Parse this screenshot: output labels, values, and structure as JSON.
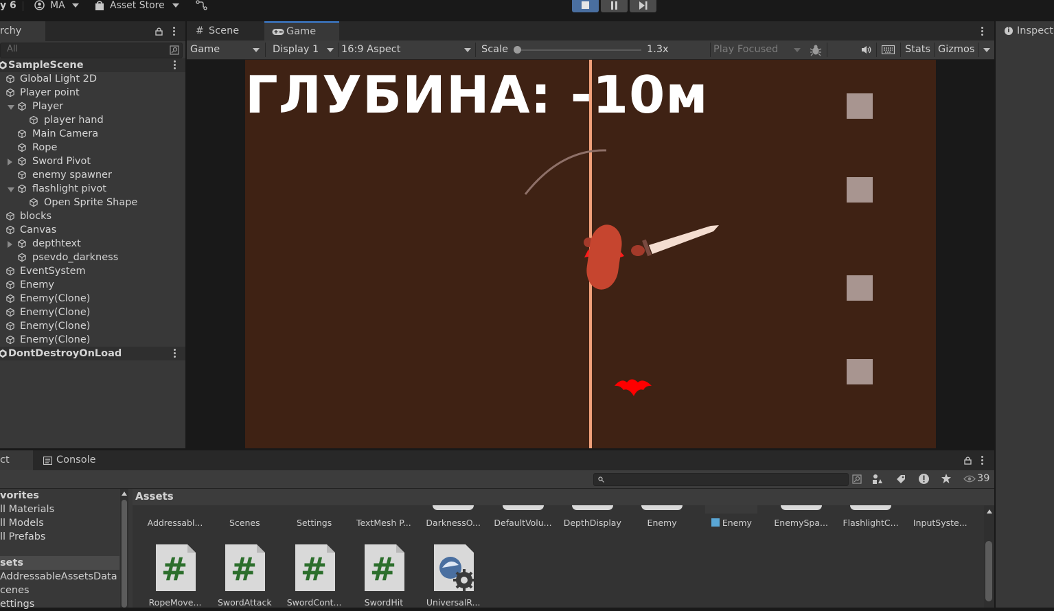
{
  "toolbar": {
    "app_fragment": "y 6",
    "account": "MA",
    "asset_store": "Asset Store"
  },
  "hierarchy": {
    "tab_label": "rchy",
    "search_placeholder": "All",
    "rows": [
      {
        "label": "SampleScene",
        "depth": 0,
        "arrow": "",
        "type": "scene"
      },
      {
        "label": "Global Light 2D",
        "depth": 1,
        "arrow": "",
        "type": "object"
      },
      {
        "label": "Player point",
        "depth": 1,
        "arrow": "",
        "type": "object"
      },
      {
        "label": "Player",
        "depth": 2,
        "arrow": "down",
        "type": "object"
      },
      {
        "label": "player hand",
        "depth": 3,
        "arrow": "",
        "type": "object"
      },
      {
        "label": "Main Camera",
        "depth": 2,
        "arrow": "",
        "type": "object"
      },
      {
        "label": "Rope",
        "depth": 2,
        "arrow": "",
        "type": "object"
      },
      {
        "label": "Sword Pivot",
        "depth": 2,
        "arrow": "right",
        "type": "object"
      },
      {
        "label": "enemy spawner",
        "depth": 2,
        "arrow": "",
        "type": "object"
      },
      {
        "label": "flashlight pivot",
        "depth": 2,
        "arrow": "down",
        "type": "object"
      },
      {
        "label": "Open Sprite Shape",
        "depth": 3,
        "arrow": "",
        "type": "object"
      },
      {
        "label": "blocks",
        "depth": 1,
        "arrow": "",
        "type": "object"
      },
      {
        "label": "Canvas",
        "depth": 1,
        "arrow": "",
        "type": "object"
      },
      {
        "label": "depthtext",
        "depth": 2,
        "arrow": "right",
        "type": "object"
      },
      {
        "label": "psevdo_darkness",
        "depth": 2,
        "arrow": "",
        "type": "object"
      },
      {
        "label": "EventSystem",
        "depth": 1,
        "arrow": "",
        "type": "object"
      },
      {
        "label": "Enemy",
        "depth": 1,
        "arrow": "",
        "type": "object"
      },
      {
        "label": "Enemy(Clone)",
        "depth": 1,
        "arrow": "",
        "type": "object"
      },
      {
        "label": "Enemy(Clone)",
        "depth": 1,
        "arrow": "",
        "type": "object"
      },
      {
        "label": "Enemy(Clone)",
        "depth": 1,
        "arrow": "",
        "type": "object"
      },
      {
        "label": "Enemy(Clone)",
        "depth": 1,
        "arrow": "",
        "type": "object"
      },
      {
        "label": "DontDestroyOnLoad",
        "depth": 0,
        "arrow": "",
        "type": "scene"
      }
    ]
  },
  "game_view": {
    "tabs": {
      "scene": "Scene",
      "game": "Game"
    },
    "controls": {
      "mode": "Game",
      "display": "Display 1",
      "aspect": "16:9 Aspect",
      "scale_label": "Scale",
      "scale_value": "1.3x",
      "play_focused": "Play Focused",
      "stats": "Stats",
      "gizmos": "Gizmos"
    },
    "depth_text": "ГЛУБИНА: -10м"
  },
  "inspector": {
    "tab_label": "Inspect"
  },
  "bottom": {
    "project_tab": "ct",
    "console_tab": "Console",
    "hidden_count": "39",
    "favorites": [
      "vorites",
      "ll Materials",
      "ll Models",
      "ll Prefabs"
    ],
    "assets_tree": [
      "sets",
      "AddressableAssetsData",
      "cenes",
      "ettings"
    ],
    "assets_header": "Assets",
    "row1": [
      "Addressabl...",
      "Scenes",
      "Settings",
      "TextMesh P...",
      "DarknessO...",
      "DefaultVolu...",
      "DepthDisplay",
      "Enemy",
      "Enemy",
      "EnemySpa...",
      "FlashlightC...",
      "InputSyste..."
    ],
    "row2": [
      "RopeMove...",
      "SwordAttack",
      "SwordCont...",
      "SwordHit",
      "UniversalR..."
    ]
  },
  "colors": {
    "game_background": "#3f2214",
    "rope": "#f0a07a",
    "player": "#c6452f",
    "enemy": "#ff0000",
    "block": "#a89590"
  }
}
